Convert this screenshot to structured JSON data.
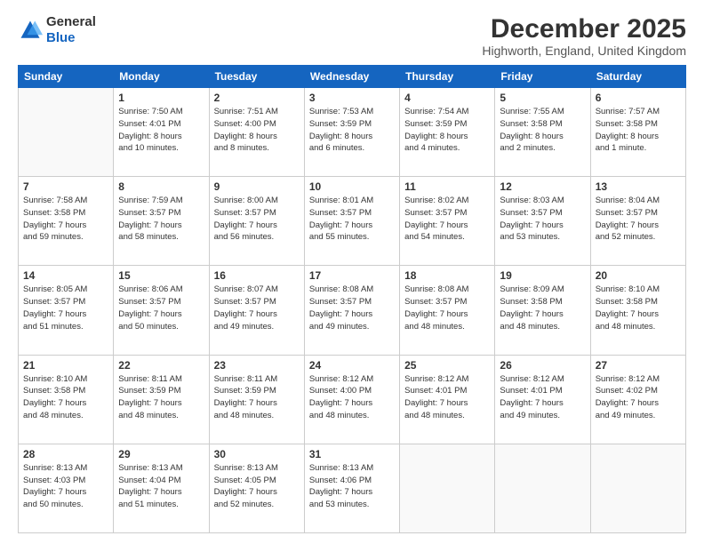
{
  "logo": {
    "general": "General",
    "blue": "Blue"
  },
  "header": {
    "month": "December 2025",
    "location": "Highworth, England, United Kingdom"
  },
  "weekdays": [
    "Sunday",
    "Monday",
    "Tuesday",
    "Wednesday",
    "Thursday",
    "Friday",
    "Saturday"
  ],
  "weeks": [
    [
      {
        "day": "",
        "content": ""
      },
      {
        "day": "1",
        "content": "Sunrise: 7:50 AM\nSunset: 4:01 PM\nDaylight: 8 hours\nand 10 minutes."
      },
      {
        "day": "2",
        "content": "Sunrise: 7:51 AM\nSunset: 4:00 PM\nDaylight: 8 hours\nand 8 minutes."
      },
      {
        "day": "3",
        "content": "Sunrise: 7:53 AM\nSunset: 3:59 PM\nDaylight: 8 hours\nand 6 minutes."
      },
      {
        "day": "4",
        "content": "Sunrise: 7:54 AM\nSunset: 3:59 PM\nDaylight: 8 hours\nand 4 minutes."
      },
      {
        "day": "5",
        "content": "Sunrise: 7:55 AM\nSunset: 3:58 PM\nDaylight: 8 hours\nand 2 minutes."
      },
      {
        "day": "6",
        "content": "Sunrise: 7:57 AM\nSunset: 3:58 PM\nDaylight: 8 hours\nand 1 minute."
      }
    ],
    [
      {
        "day": "7",
        "content": "Sunrise: 7:58 AM\nSunset: 3:58 PM\nDaylight: 7 hours\nand 59 minutes."
      },
      {
        "day": "8",
        "content": "Sunrise: 7:59 AM\nSunset: 3:57 PM\nDaylight: 7 hours\nand 58 minutes."
      },
      {
        "day": "9",
        "content": "Sunrise: 8:00 AM\nSunset: 3:57 PM\nDaylight: 7 hours\nand 56 minutes."
      },
      {
        "day": "10",
        "content": "Sunrise: 8:01 AM\nSunset: 3:57 PM\nDaylight: 7 hours\nand 55 minutes."
      },
      {
        "day": "11",
        "content": "Sunrise: 8:02 AM\nSunset: 3:57 PM\nDaylight: 7 hours\nand 54 minutes."
      },
      {
        "day": "12",
        "content": "Sunrise: 8:03 AM\nSunset: 3:57 PM\nDaylight: 7 hours\nand 53 minutes."
      },
      {
        "day": "13",
        "content": "Sunrise: 8:04 AM\nSunset: 3:57 PM\nDaylight: 7 hours\nand 52 minutes."
      }
    ],
    [
      {
        "day": "14",
        "content": "Sunrise: 8:05 AM\nSunset: 3:57 PM\nDaylight: 7 hours\nand 51 minutes."
      },
      {
        "day": "15",
        "content": "Sunrise: 8:06 AM\nSunset: 3:57 PM\nDaylight: 7 hours\nand 50 minutes."
      },
      {
        "day": "16",
        "content": "Sunrise: 8:07 AM\nSunset: 3:57 PM\nDaylight: 7 hours\nand 49 minutes."
      },
      {
        "day": "17",
        "content": "Sunrise: 8:08 AM\nSunset: 3:57 PM\nDaylight: 7 hours\nand 49 minutes."
      },
      {
        "day": "18",
        "content": "Sunrise: 8:08 AM\nSunset: 3:57 PM\nDaylight: 7 hours\nand 48 minutes."
      },
      {
        "day": "19",
        "content": "Sunrise: 8:09 AM\nSunset: 3:58 PM\nDaylight: 7 hours\nand 48 minutes."
      },
      {
        "day": "20",
        "content": "Sunrise: 8:10 AM\nSunset: 3:58 PM\nDaylight: 7 hours\nand 48 minutes."
      }
    ],
    [
      {
        "day": "21",
        "content": "Sunrise: 8:10 AM\nSunset: 3:58 PM\nDaylight: 7 hours\nand 48 minutes."
      },
      {
        "day": "22",
        "content": "Sunrise: 8:11 AM\nSunset: 3:59 PM\nDaylight: 7 hours\nand 48 minutes."
      },
      {
        "day": "23",
        "content": "Sunrise: 8:11 AM\nSunset: 3:59 PM\nDaylight: 7 hours\nand 48 minutes."
      },
      {
        "day": "24",
        "content": "Sunrise: 8:12 AM\nSunset: 4:00 PM\nDaylight: 7 hours\nand 48 minutes."
      },
      {
        "day": "25",
        "content": "Sunrise: 8:12 AM\nSunset: 4:01 PM\nDaylight: 7 hours\nand 48 minutes."
      },
      {
        "day": "26",
        "content": "Sunrise: 8:12 AM\nSunset: 4:01 PM\nDaylight: 7 hours\nand 49 minutes."
      },
      {
        "day": "27",
        "content": "Sunrise: 8:12 AM\nSunset: 4:02 PM\nDaylight: 7 hours\nand 49 minutes."
      }
    ],
    [
      {
        "day": "28",
        "content": "Sunrise: 8:13 AM\nSunset: 4:03 PM\nDaylight: 7 hours\nand 50 minutes."
      },
      {
        "day": "29",
        "content": "Sunrise: 8:13 AM\nSunset: 4:04 PM\nDaylight: 7 hours\nand 51 minutes."
      },
      {
        "day": "30",
        "content": "Sunrise: 8:13 AM\nSunset: 4:05 PM\nDaylight: 7 hours\nand 52 minutes."
      },
      {
        "day": "31",
        "content": "Sunrise: 8:13 AM\nSunset: 4:06 PM\nDaylight: 7 hours\nand 53 minutes."
      },
      {
        "day": "",
        "content": ""
      },
      {
        "day": "",
        "content": ""
      },
      {
        "day": "",
        "content": ""
      }
    ]
  ]
}
